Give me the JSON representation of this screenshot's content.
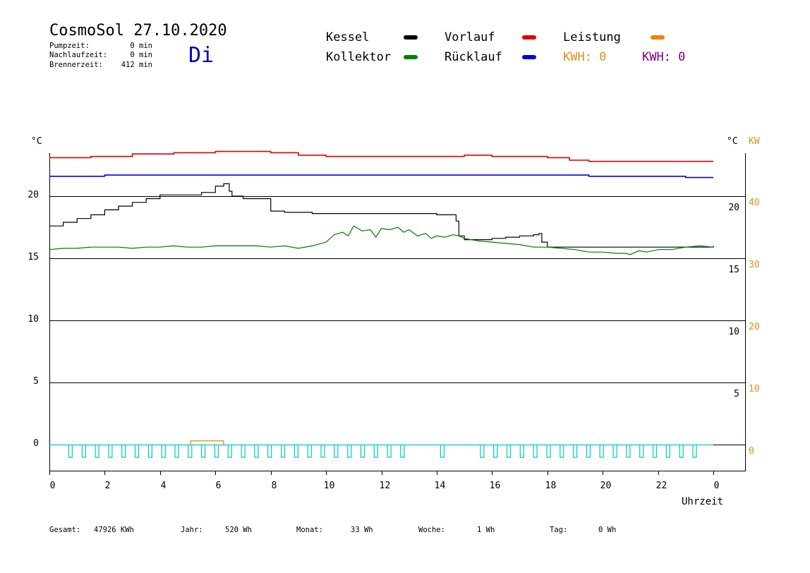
{
  "header": {
    "title": "CosmoSol 27.10.2020",
    "weekday": "Di",
    "stats": [
      {
        "label": "Pumpzeit:",
        "value": "0 min"
      },
      {
        "label": "Nachlaufzeit:",
        "value": "0 min"
      },
      {
        "label": "Brennerzeit:",
        "value": "412 min"
      }
    ]
  },
  "legend": {
    "items": [
      {
        "label": "Kessel",
        "color": "#000000"
      },
      {
        "label": "Vorlauf",
        "color": "#e00000"
      },
      {
        "label": "Leistung",
        "color": "#f08000"
      },
      {
        "label": "Kollektor",
        "color": "#008000"
      },
      {
        "label": "Rücklauf",
        "color": "#0000e0"
      }
    ],
    "kwh_orange": "KWH: 0",
    "kwh_purple": "KWH: 0"
  },
  "colors": {
    "kessel": "#000000",
    "vorlauf": "#e00000",
    "ruecklauf": "#0000e0",
    "kollektor": "#007a00",
    "leistung": "#f08000",
    "pump": "#00c8c8",
    "orange_axis": "#e09020",
    "purple": "#800080",
    "weekday": "#0000c0"
  },
  "footer": [
    {
      "label": "Gesamt:",
      "value": "47926 KWh"
    },
    {
      "label": "Jahr:",
      "value": "520 Wh"
    },
    {
      "label": "Monat:",
      "value": "33 Wh"
    },
    {
      "label": "Woche:",
      "value": "1 Wh"
    },
    {
      "label": "Tag:",
      "value": "0 Wh"
    }
  ],
  "chart_data": {
    "type": "line",
    "xlabel": "Uhrzeit",
    "ylabel_left": "°C",
    "ylabel_right": "°C",
    "ylabel_right2": "KW",
    "xlim": [
      0,
      24
    ],
    "ylim": [
      -1.8,
      24.8
    ],
    "x_ticks": [
      "0",
      "2",
      "4",
      "6",
      "8",
      "10",
      "12",
      "14",
      "16",
      "18",
      "20",
      "22",
      "0"
    ],
    "y_ticks_left": [
      "0",
      "5",
      "10",
      "15",
      "20"
    ],
    "y_ticks_right": [
      "5",
      "10",
      "15",
      "20"
    ],
    "y_ticks_kw": [
      "0",
      "10",
      "20",
      "30",
      "40"
    ],
    "series": [
      {
        "name": "Vorlauf",
        "x": [
          0,
          1.5,
          3,
          4.5,
          6,
          7,
          8,
          9,
          10,
          11,
          12,
          13,
          14,
          15,
          16,
          17,
          18,
          18.8,
          19.5,
          20,
          21,
          22,
          23,
          24
        ],
        "y": [
          23.1,
          23.2,
          23.4,
          23.5,
          23.6,
          23.6,
          23.5,
          23.3,
          23.2,
          23.2,
          23.2,
          23.2,
          23.2,
          23.3,
          23.2,
          23.2,
          23.1,
          22.9,
          22.8,
          22.8,
          22.8,
          22.8,
          22.8,
          22.8
        ]
      },
      {
        "name": "Rücklauf",
        "x": [
          0,
          2,
          4,
          6,
          8,
          10,
          12,
          14,
          16,
          18,
          19.5,
          20,
          22,
          23,
          24
        ],
        "y": [
          21.6,
          21.7,
          21.7,
          21.7,
          21.7,
          21.7,
          21.7,
          21.7,
          21.7,
          21.7,
          21.6,
          21.6,
          21.6,
          21.5,
          21.5
        ]
      },
      {
        "name": "Kessel",
        "x": [
          0,
          0.5,
          1,
          1.5,
          2,
          2.5,
          3,
          3.5,
          4,
          4.5,
          5,
          5.5,
          6,
          6.3,
          6.4,
          6.5,
          6.6,
          7,
          7.5,
          7.8,
          8,
          8.5,
          9,
          9.5,
          10,
          11,
          12,
          13,
          14,
          14.5,
          14.7,
          14.8,
          15,
          15.5,
          16,
          16.5,
          17,
          17.5,
          17.7,
          17.8,
          18,
          19,
          20,
          21,
          22,
          23,
          24
        ],
        "y": [
          17.6,
          17.9,
          18.2,
          18.5,
          18.9,
          19.2,
          19.5,
          19.8,
          20.1,
          20.1,
          20.1,
          20.3,
          20.8,
          21.0,
          21.0,
          20.4,
          20.0,
          19.8,
          19.8,
          19.8,
          18.8,
          18.7,
          18.7,
          18.6,
          18.6,
          18.6,
          18.6,
          18.6,
          18.5,
          18.5,
          18.0,
          16.8,
          16.5,
          16.5,
          16.6,
          16.7,
          16.8,
          16.9,
          17.0,
          16.3,
          15.9,
          15.9,
          15.9,
          15.9,
          15.9,
          15.9,
          16.0
        ]
      },
      {
        "name": "Kollektor",
        "x": [
          0,
          0.5,
          1,
          1.5,
          2,
          2.5,
          3,
          3.5,
          4,
          4.5,
          5,
          5.5,
          6,
          6.5,
          7,
          7.5,
          8,
          8.5,
          9,
          9.5,
          10,
          10.3,
          10.6,
          10.8,
          11,
          11.3,
          11.6,
          11.8,
          12,
          12.3,
          12.6,
          12.8,
          13,
          13.3,
          13.6,
          13.8,
          14,
          14.3,
          14.6,
          14.8,
          15,
          15.5,
          16,
          16.5,
          17,
          17.5,
          18,
          18.5,
          19,
          19.5,
          20,
          20.5,
          20.8,
          21,
          21.3,
          21.6,
          22,
          22.5,
          23,
          23.5,
          24
        ],
        "y": [
          15.7,
          15.8,
          15.8,
          15.9,
          15.9,
          15.9,
          15.8,
          15.9,
          15.9,
          16.0,
          15.9,
          15.9,
          16.0,
          16.0,
          16.0,
          16.0,
          15.9,
          16.0,
          15.8,
          16.0,
          16.3,
          16.9,
          17.1,
          16.8,
          17.6,
          17.2,
          17.3,
          16.7,
          17.4,
          17.3,
          17.5,
          17.1,
          17.3,
          16.8,
          17.0,
          16.6,
          16.8,
          16.7,
          16.9,
          16.8,
          16.6,
          16.4,
          16.3,
          16.2,
          16.1,
          15.9,
          15.9,
          15.8,
          15.7,
          15.5,
          15.5,
          15.4,
          15.4,
          15.3,
          15.6,
          15.5,
          15.7,
          15.7,
          15.9,
          16.0,
          15.9
        ]
      },
      {
        "name": "Leistung",
        "x": [
          5.1,
          6.3
        ],
        "y": [
          0.3,
          0.3
        ]
      }
    ]
  }
}
